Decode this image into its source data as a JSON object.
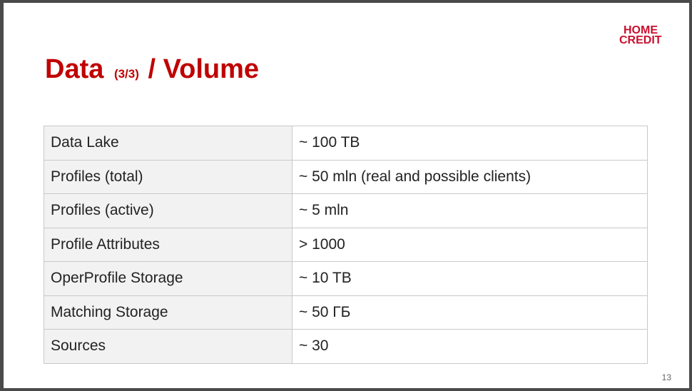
{
  "logo": {
    "line1": "HOME",
    "line2": "CREDIT"
  },
  "title": {
    "main": "Data",
    "sub": "(3/3)",
    "rest": "/ Volume"
  },
  "table": {
    "rows": [
      {
        "key": "Data Lake",
        "value": "~ 100 TB"
      },
      {
        "key": "Profiles (total)",
        "value": "~ 50 mln (real and possible clients)"
      },
      {
        "key": "Profiles (active)",
        "value": "~ 5 mln"
      },
      {
        "key": "Profile Attributes",
        "value": "> 1000"
      },
      {
        "key": "OperProfile Storage",
        "value": "~ 10 TB"
      },
      {
        "key": "Matching Storage",
        "value": "~ 50 ГБ"
      },
      {
        "key": "Sources",
        "value": "~ 30"
      }
    ]
  },
  "page_number": "13",
  "colors": {
    "brand": "#c8102e",
    "title": "#c00000",
    "key_cell_bg": "#f2f2f2"
  }
}
